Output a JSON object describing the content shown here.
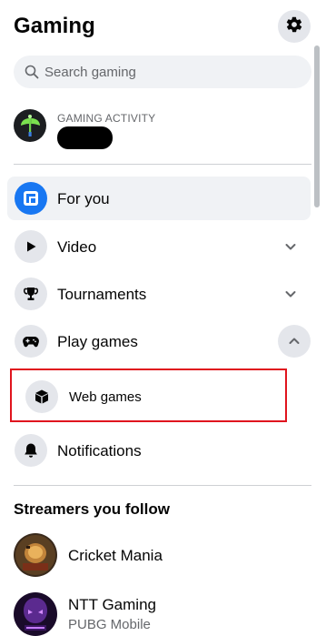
{
  "header": {
    "title": "Gaming",
    "settings_icon": "gear-icon"
  },
  "search": {
    "placeholder": "Search gaming",
    "icon": "search-icon"
  },
  "activity": {
    "label": "GAMING ACTIVITY",
    "avatar_icon": "axe-avatar-icon",
    "name_redacted": true
  },
  "nav": {
    "items": [
      {
        "label": "For you",
        "icon": "for-you-icon",
        "active": true
      },
      {
        "label": "Video",
        "icon": "play-icon",
        "chevron": "down"
      },
      {
        "label": "Tournaments",
        "icon": "trophy-icon",
        "chevron": "down"
      },
      {
        "label": "Play games",
        "icon": "gamepad-icon",
        "chevron": "up"
      }
    ],
    "sub_items": [
      {
        "label": "Web games",
        "icon": "cube-icon",
        "highlighted": true
      }
    ],
    "notifications": {
      "label": "Notifications",
      "icon": "bell-icon"
    }
  },
  "streamers": {
    "heading": "Streamers you follow",
    "items": [
      {
        "name": "Cricket Mania",
        "subtitle": ""
      },
      {
        "name": "NTT Gaming",
        "subtitle": "PUBG Mobile"
      }
    ]
  },
  "colors": {
    "accent": "#1877f2",
    "highlight_border": "#e0141e",
    "active_bg": "#f0f2f5",
    "icon_bg": "#e4e6eb"
  }
}
